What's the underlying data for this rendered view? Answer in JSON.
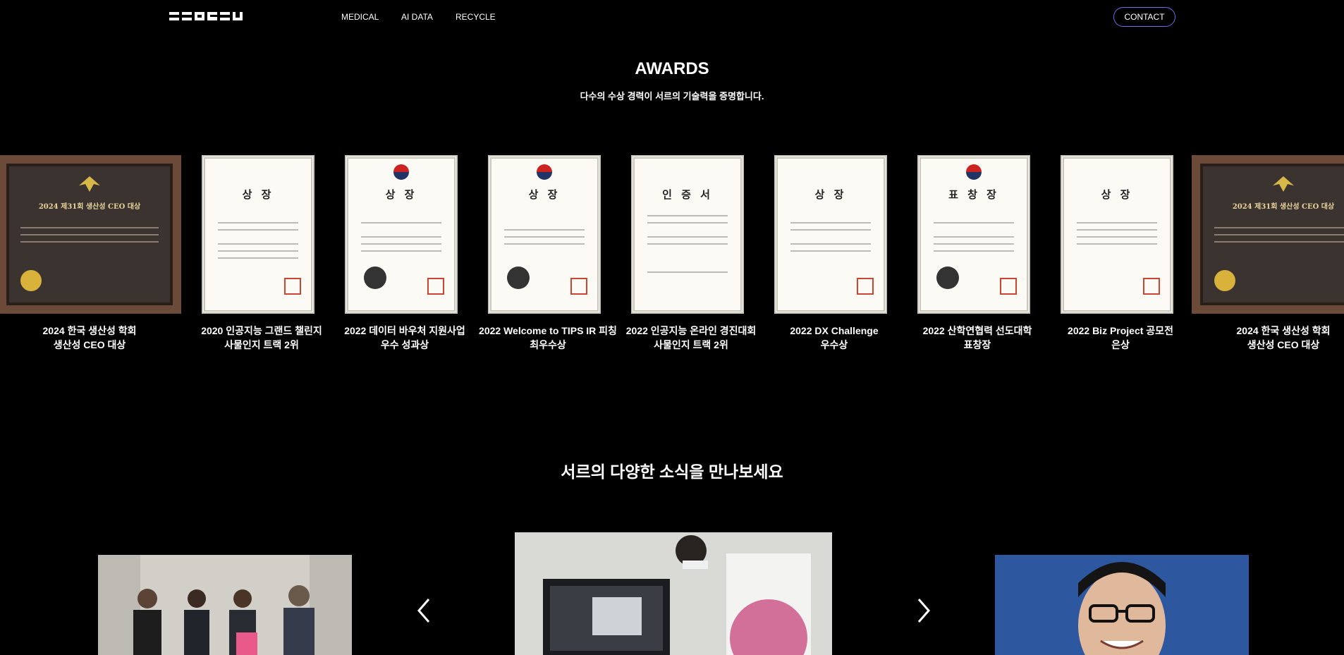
{
  "nav": {
    "logo_text": "SEORSU",
    "links": [
      "MEDICAL",
      "AI DATA",
      "RECYCLE"
    ],
    "contact_label": "CONTACT"
  },
  "awards": {
    "title": "AWARDS",
    "subtitle": "다수의 수상 경력이 서르의 기술력을 증명합니다.",
    "items": [
      {
        "line1": "2024 한국 생산성 학회",
        "line2": "생산성 CEO 대상",
        "type": "plaque",
        "cert_title": "2024 제31회 생산성 CEO 대상"
      },
      {
        "line1": "2020 인공지능 그랜드 챌린지",
        "line2": "사물인지 트랙 2위",
        "type": "paper",
        "cert_title": "상 장"
      },
      {
        "line1": "2022 데이터 바우처 지원사업",
        "line2": "우수 성과상",
        "type": "paper",
        "cert_title": "상 장"
      },
      {
        "line1": "2022 Welcome to TIPS IR 피칭",
        "line2": "최우수상",
        "type": "paper",
        "cert_title": "상 장"
      },
      {
        "line1": "2022 인공지능 온라인 경진대회",
        "line2": "사물인지 트랙 2위",
        "type": "paper",
        "cert_title": "인 증 서"
      },
      {
        "line1": "2022 DX Challenge",
        "line2": "우수상",
        "type": "paper",
        "cert_title": "상 장"
      },
      {
        "line1": "2022 산학연협력 선도대학",
        "line2": "표창장",
        "type": "paper",
        "cert_title": "표 창 장"
      },
      {
        "line1": "2022 Biz Project 공모전",
        "line2": "은상",
        "type": "paper",
        "cert_title": "상 장"
      },
      {
        "line1": "2024 한국 생산성 학회",
        "line2": "생산성 CEO 대상",
        "type": "plaque",
        "cert_title": "2024 제31회 생산성 CEO 대상"
      }
    ]
  },
  "news": {
    "title": "서르의 다양한 소식을 만나보세요",
    "prev_icon": "chevron-left-icon",
    "next_icon": "chevron-right-icon"
  },
  "colors": {
    "background": "#000000",
    "contact_border": "#6b6ee8",
    "plaque_frame": "#6c4a3a"
  }
}
